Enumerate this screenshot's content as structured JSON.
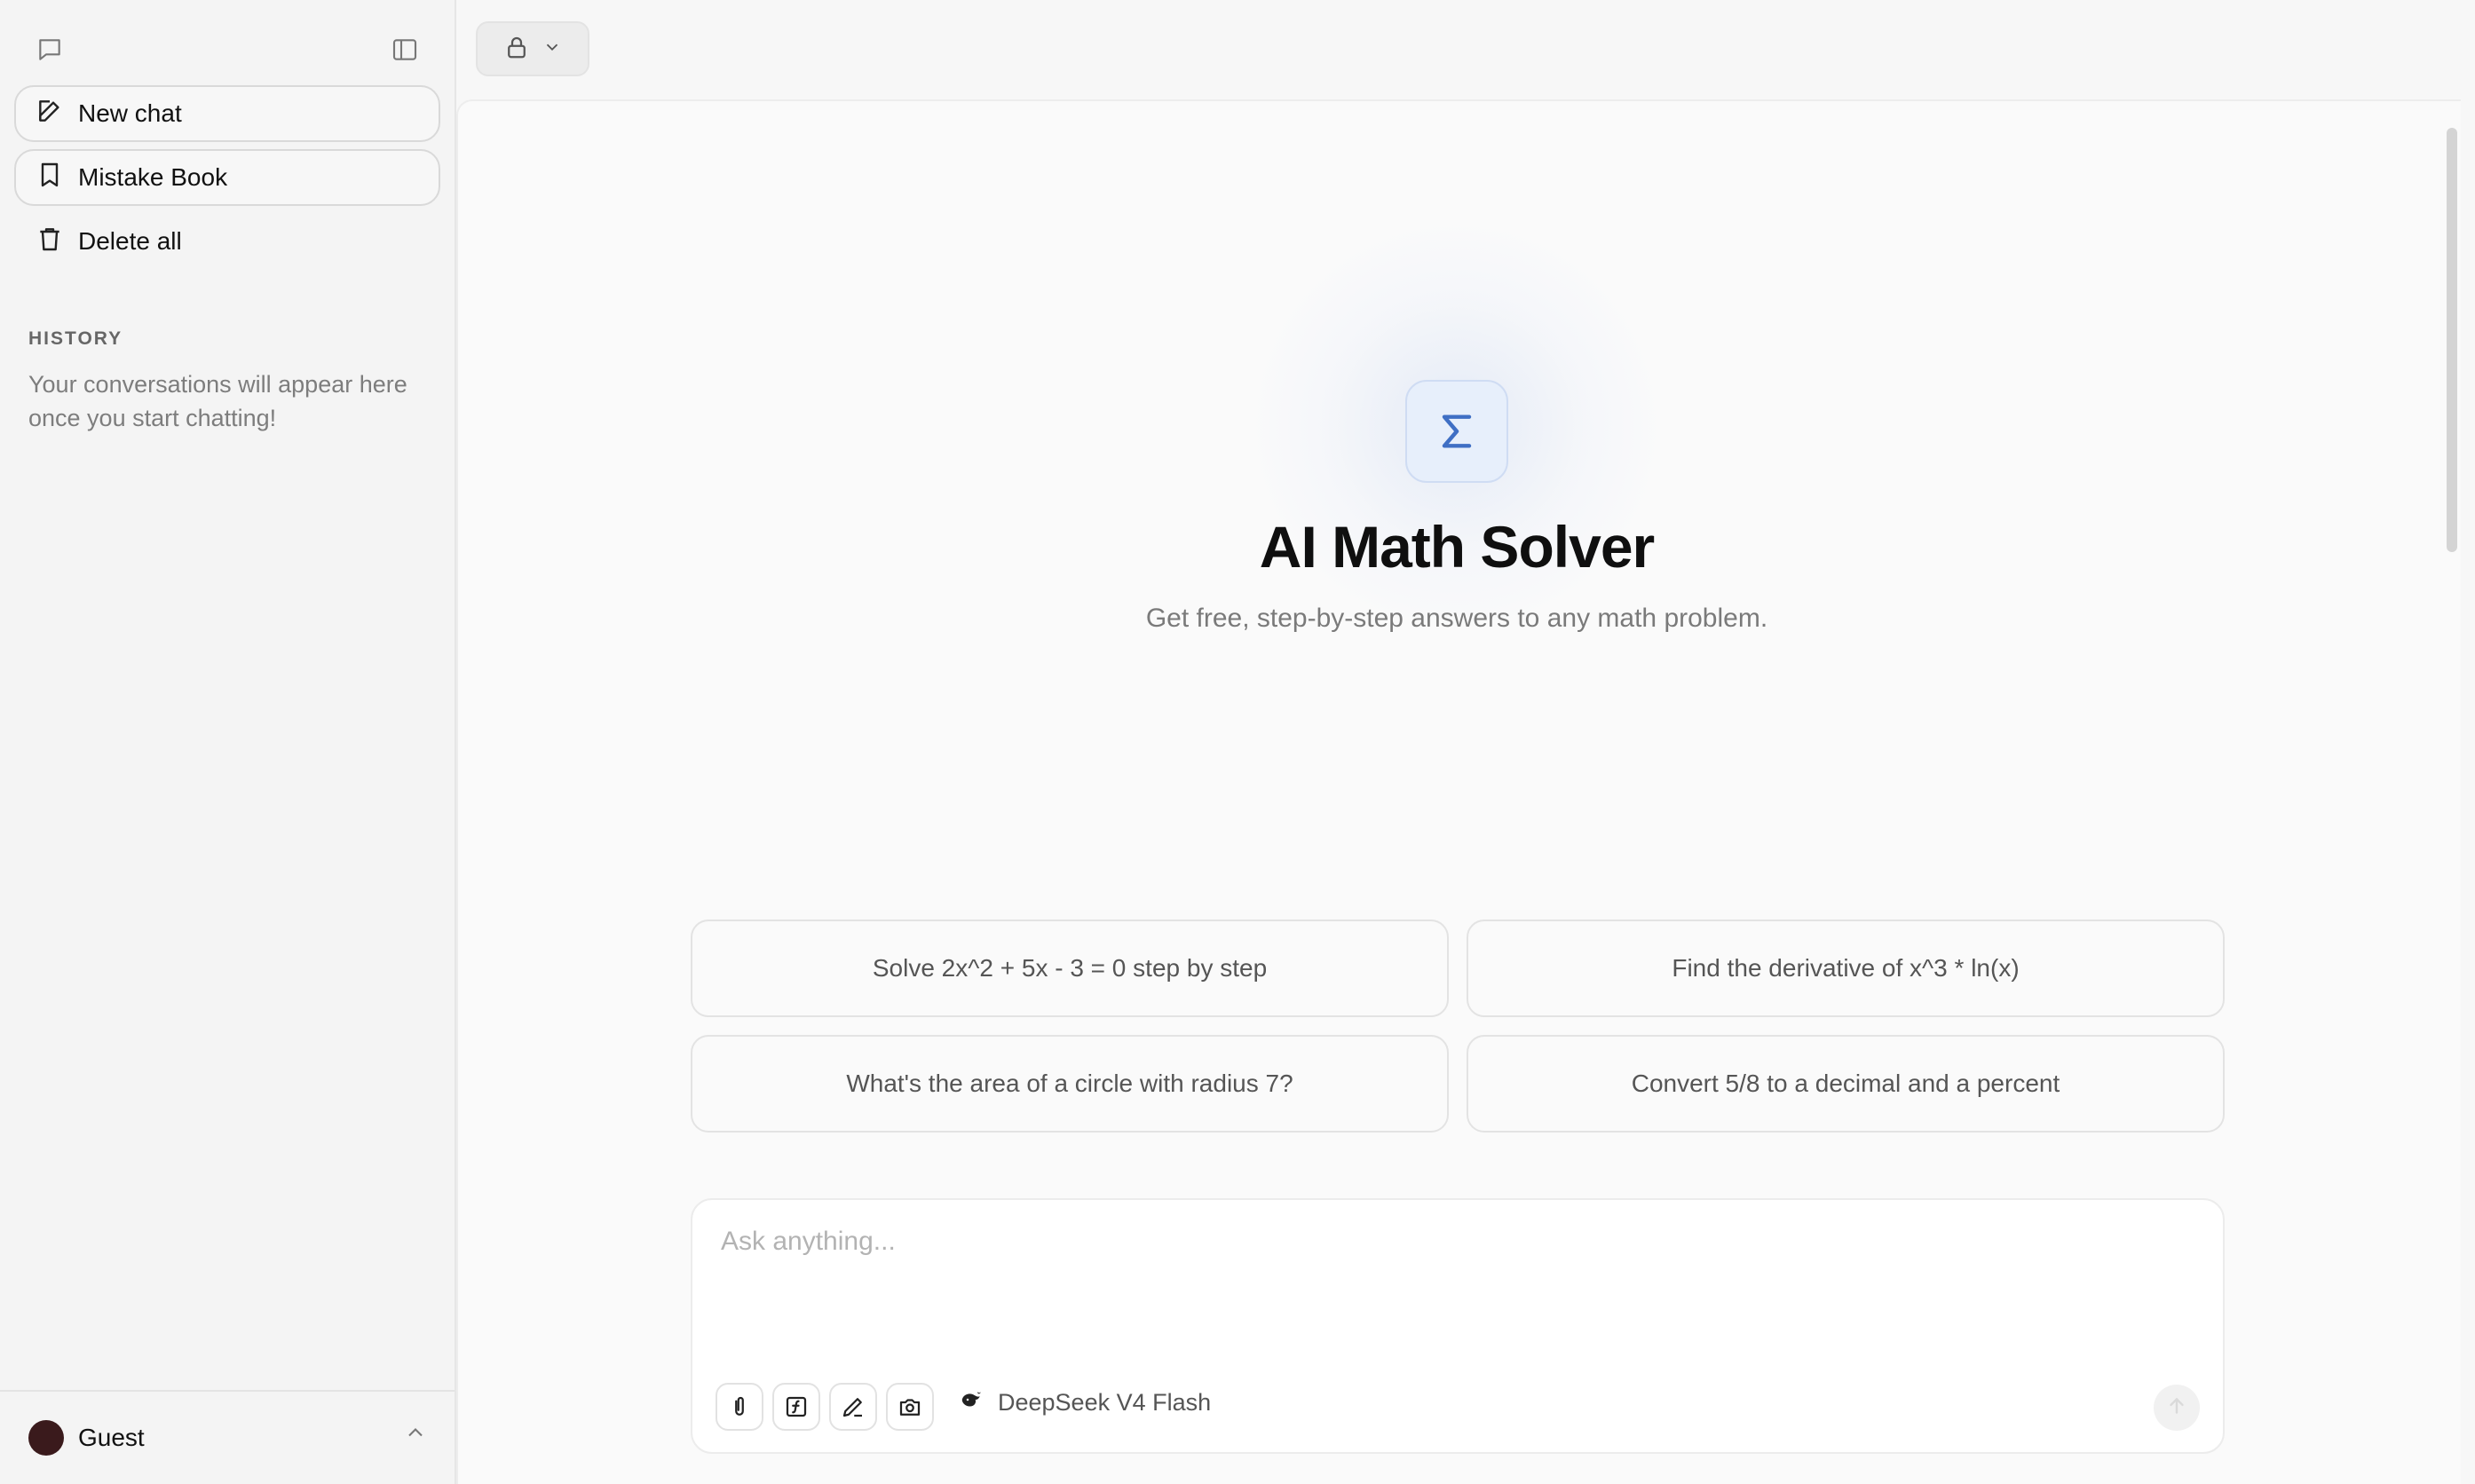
{
  "sidebar": {
    "new_chat_label": "New chat",
    "mistake_book_label": "Mistake Book",
    "delete_all_label": "Delete all",
    "history_heading": "HISTORY",
    "history_empty": "Your conversations will appear here once you start chatting!",
    "user_name": "Guest"
  },
  "hero": {
    "title": "AI Math Solver",
    "subtitle": "Get free, step-by-step answers to any math problem."
  },
  "suggestions": [
    "Solve 2x^2 + 5x - 3 = 0 step by step",
    "Find the derivative of x^3 * ln(x)",
    "What's the area of a circle with radius 7?",
    "Convert 5/8 to a decimal and a percent"
  ],
  "composer": {
    "placeholder": "Ask anything...",
    "model_name": "DeepSeek V4 Flash"
  },
  "icons": {
    "logo": "sigma-icon",
    "attach": "paperclip-icon",
    "formula": "function-icon",
    "draw": "pencil-icon",
    "camera": "camera-icon",
    "model": "whale-icon"
  },
  "colors": {
    "accent": "#3f6fc4",
    "logo_tile_bg": "#e7effb",
    "avatar": "#3a1a1c"
  }
}
